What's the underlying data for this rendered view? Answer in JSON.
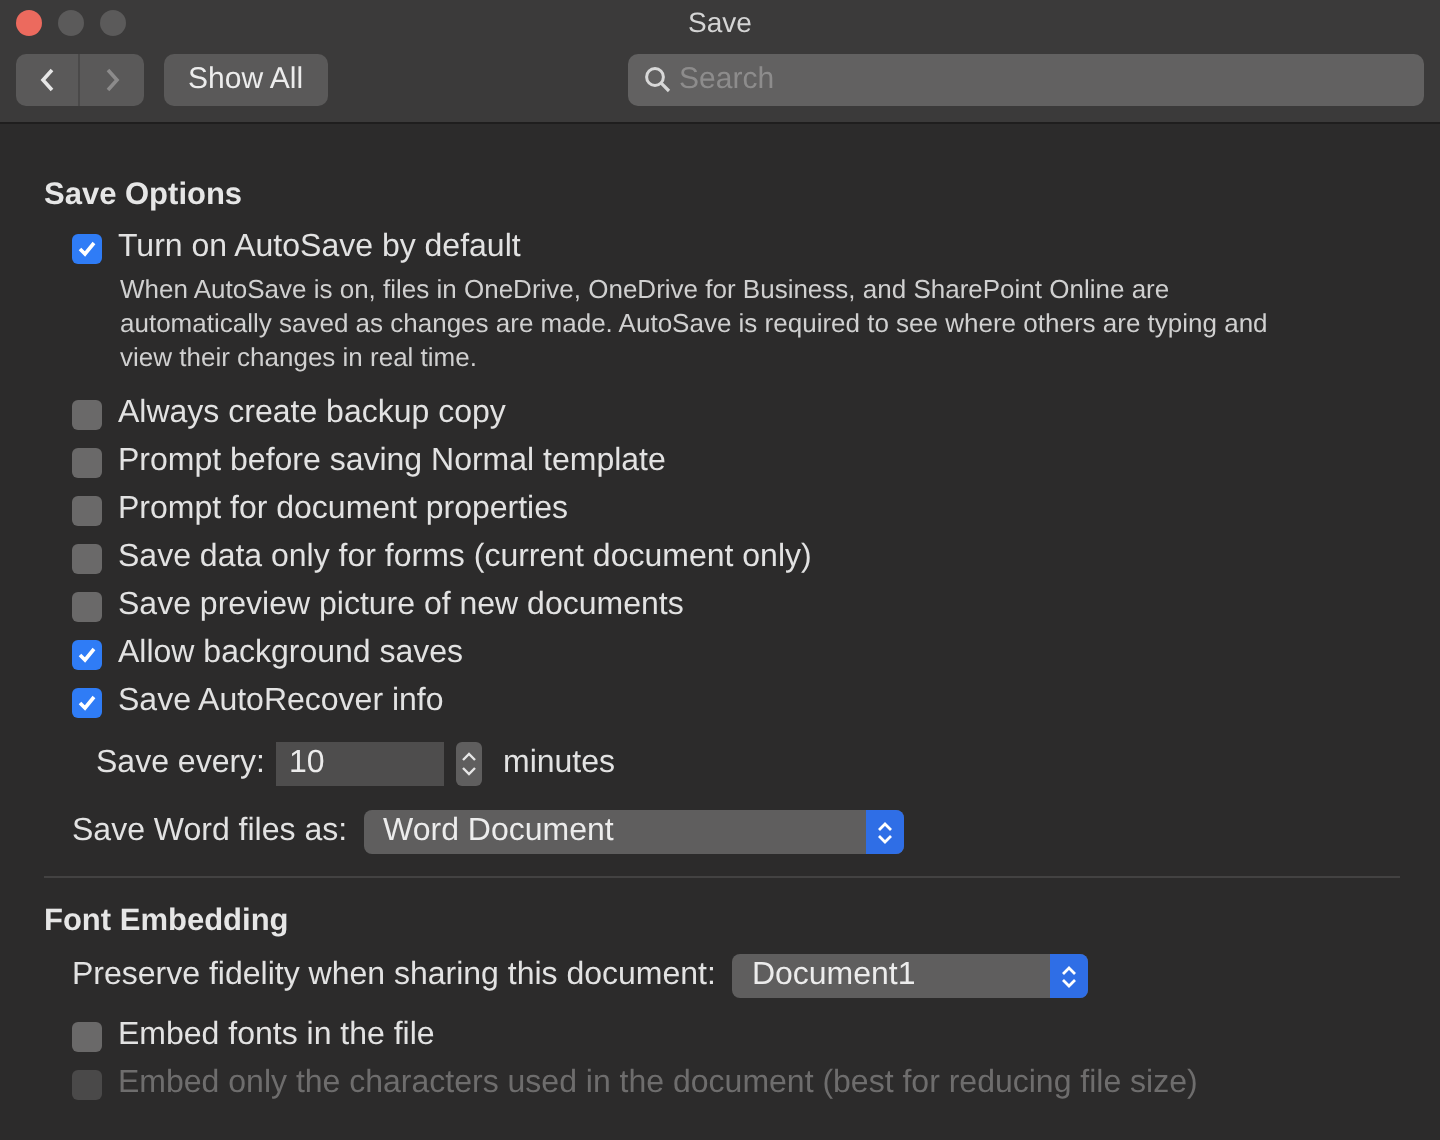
{
  "window": {
    "title": "Save"
  },
  "toolbar": {
    "show_all": "Show All",
    "search": {
      "placeholder": "Search"
    }
  },
  "save_options": {
    "heading": "Save Options",
    "items": [
      {
        "label": "Turn on AutoSave by default",
        "checked": true,
        "disabled": false,
        "description": "When AutoSave is on, files in OneDrive, OneDrive for Business, and SharePoint Online are automatically saved as changes are made. AutoSave is required to see where others are typing and view their changes in real time."
      },
      {
        "label": "Always create backup copy",
        "checked": false,
        "disabled": false
      },
      {
        "label": "Prompt before saving Normal template",
        "checked": false,
        "disabled": false
      },
      {
        "label": "Prompt for document properties",
        "checked": false,
        "disabled": false
      },
      {
        "label": "Save data only for forms (current document only)",
        "checked": false,
        "disabled": false
      },
      {
        "label": "Save preview picture of new documents",
        "checked": false,
        "disabled": false
      },
      {
        "label": "Allow background saves",
        "checked": true,
        "disabled": false
      },
      {
        "label": "Save AutoRecover info",
        "checked": true,
        "disabled": false
      }
    ],
    "save_every": {
      "label": "Save every:",
      "value": "10",
      "unit": "minutes"
    },
    "save_as": {
      "label": "Save Word files as:",
      "value": "Word Document"
    }
  },
  "font_embedding": {
    "heading": "Font Embedding",
    "preserve": {
      "label": "Preserve fidelity when sharing this document:",
      "value": "Document1"
    },
    "items": [
      {
        "label": "Embed fonts in the file",
        "checked": false,
        "disabled": false
      },
      {
        "label": "Embed only the characters used in the document (best for reducing file size)",
        "checked": false,
        "disabled": true
      }
    ]
  }
}
